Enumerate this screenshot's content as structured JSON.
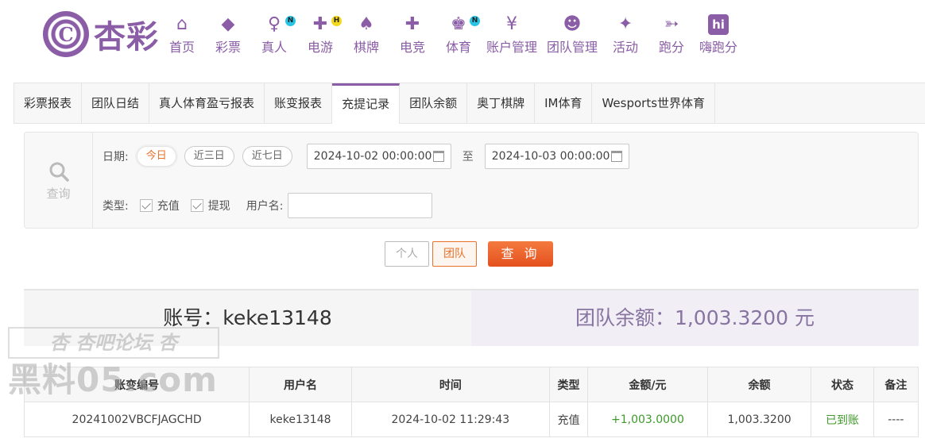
{
  "brand": {
    "logo_text": "杏彩",
    "mark": "C"
  },
  "nav": [
    {
      "label": "首页",
      "icon": "home-icon",
      "glyph": "⌂",
      "badge": ""
    },
    {
      "label": "彩票",
      "icon": "ticket-icon",
      "glyph": "◆",
      "badge": ""
    },
    {
      "label": "真人",
      "icon": "live-dealer-icon",
      "glyph": "♀",
      "badge": "N"
    },
    {
      "label": "电游",
      "icon": "gamepad-icon",
      "glyph": "✚",
      "badge": "H"
    },
    {
      "label": "棋牌",
      "icon": "cards-icon",
      "glyph": "♠",
      "badge": ""
    },
    {
      "label": "电竞",
      "icon": "esports-controller-icon",
      "glyph": "✚",
      "badge": ""
    },
    {
      "label": "体育",
      "icon": "trophy-icon",
      "glyph": "♚",
      "badge": "N"
    },
    {
      "label": "账户管理",
      "icon": "yen-coin-icon",
      "glyph": "¥",
      "badge": ""
    },
    {
      "label": "团队管理",
      "icon": "team-icon",
      "glyph": "☻",
      "badge": ""
    },
    {
      "label": "活动",
      "icon": "gift-icon",
      "glyph": "✦",
      "badge": ""
    },
    {
      "label": "跑分",
      "icon": "running-shoe-icon",
      "glyph": "➳",
      "badge": ""
    },
    {
      "label": "嗨跑分",
      "icon": "hi-badge-icon",
      "glyph": "hi",
      "badge": ""
    }
  ],
  "tabs": [
    "彩票报表",
    "团队日结",
    "真人体育盈亏报表",
    "账变报表",
    "充提记录",
    "团队余额",
    "奥丁棋牌",
    "IM体育",
    "Wesports世界体育"
  ],
  "active_tab": "充提记录",
  "filter": {
    "query_label": "查询",
    "date_label": "日期:",
    "presets": [
      "今日",
      "近三日",
      "近七日"
    ],
    "date_from": "2024-10-02 00:00:00",
    "date_sep": "至",
    "date_to": "2024-10-03 00:00:00",
    "type_label": "类型:",
    "types": [
      "充值",
      "提现"
    ],
    "user_label": "用户名:",
    "user_value": ""
  },
  "buttons": {
    "personal": "个人",
    "team": "团队",
    "query": "查 询"
  },
  "summary": {
    "account": "账号：keke13148",
    "balance": "团队余额：1,003.3200 元"
  },
  "watermark": {
    "line1": "杏 杏吧论坛 杏",
    "line2": "黑料05.com"
  },
  "table": {
    "headers": [
      "账变编号",
      "用户名",
      "时间",
      "类型",
      "金额/元",
      "余额",
      "状态",
      "备注"
    ],
    "rows": [
      [
        "20241002VBCFJAGCHD",
        "keke13148",
        "2024-10-02 11:29:43",
        "充值",
        "+1,003.0000",
        "1,003.3200",
        "已到账",
        "----"
      ]
    ]
  },
  "colors": {
    "brand": "#8a5da6",
    "accent": "#e8722a",
    "success": "#3d9a2a"
  }
}
